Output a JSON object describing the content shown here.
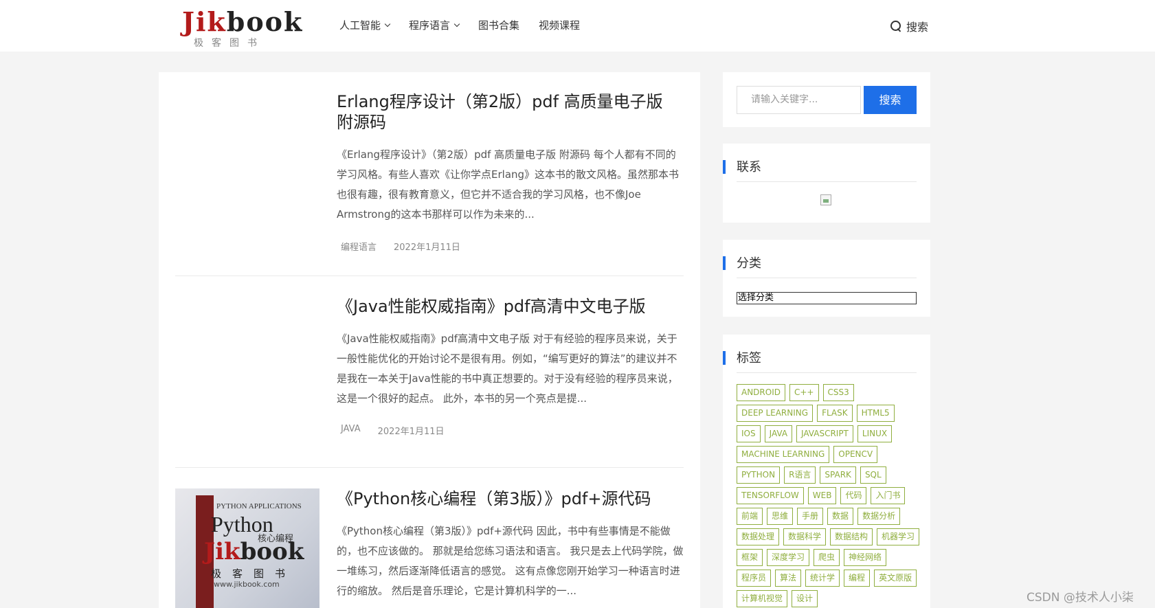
{
  "header": {
    "logo_text_red": "Jik",
    "logo_text_dark": "book",
    "logo_sub": "极客图书",
    "nav": [
      {
        "label": "人工智能",
        "dropdown": true
      },
      {
        "label": "程序语言",
        "dropdown": true
      },
      {
        "label": "图书合集",
        "dropdown": false
      },
      {
        "label": "视频课程",
        "dropdown": false
      }
    ],
    "search_label": "搜索"
  },
  "posts": [
    {
      "title": "Erlang程序设计（第2版）pdf 高质量电子版 附源码",
      "excerpt": "《Erlang程序设计》（第2版）pdf 高质量电子版 附源码 每个人都有不同的学习风格。有些人喜欢《让你学点Erlang》这本书的散文风格。虽然那本书也很有趣，很有教育意义，但它并不适合我的学习风格，也不像Joe Armstrong的这本书那样可以作为未来的...",
      "category": "编程语言",
      "date": "2022年1月11日"
    },
    {
      "title": "《Java性能权威指南》pdf高清中文电子版",
      "excerpt": "《Java性能权威指南》pdf高清中文电子版 对于有经验的程序员来说，关于一般性能优化的开始讨论不是很有用。例如，“编写更好的算法”的建议并不是我在一本关于Java性能的书中真正想要的。对于没有经验的程序员来说，这是一个很好的起点。 此外，本书的另一个亮点是提...",
      "category": "JAVA",
      "date": "2022年1月11日"
    },
    {
      "title": "《Python核心编程（第3版）》pdf+源代码",
      "excerpt": "《Python核心编程（第3版）》pdf+源代码 因此，书中有些事情是不能做的，也不应该做的。 那就是给您练习语法和语言。 我只是去上代码学院，做一堆练习，然后逐渐降低语言的感觉。 这有点像您刚开始学习一种语言时进行的缩放。 然后是音乐理论，它是计算机科学的一...",
      "cover": {
        "top_text": "PYTHON APPLICATIONS",
        "title": "Python",
        "cn": "核心编程",
        "watermark_red": "Jik",
        "watermark_dark": "book",
        "watermark_sub": "极客图书",
        "url": "www.jikbook.com"
      }
    }
  ],
  "sidebar": {
    "search_placeholder": "请输入关键字...",
    "search_button": "搜索",
    "contact_title": "联系",
    "category_title": "分类",
    "category_select": "选择分类",
    "tags_title": "标签",
    "tags": [
      "ANDROID",
      "C++",
      "CSS3",
      "DEEP LEARNING",
      "FLASK",
      "HTML5",
      "IOS",
      "JAVA",
      "JAVASCRIPT",
      "LINUX",
      "MACHINE LEARNING",
      "OPENCV",
      "PYTHON",
      "R语言",
      "SPARK",
      "SQL",
      "TENSORFLOW",
      "WEB",
      "代码",
      "入门书",
      "前端",
      "思维",
      "手册",
      "数据",
      "数据分析",
      "数据处理",
      "数据科学",
      "数据结构",
      "机器学习",
      "框架",
      "深度学习",
      "爬虫",
      "神经网络",
      "程序员",
      "算法",
      "统计学",
      "编程",
      "英文原版",
      "计算机视觉",
      "设计"
    ]
  },
  "watermark": "CSDN @技术人小柒",
  "colors": {
    "accent": "#1e6fe8",
    "logo_red": "#b31b1b",
    "tag_green": "#8fae3e"
  }
}
